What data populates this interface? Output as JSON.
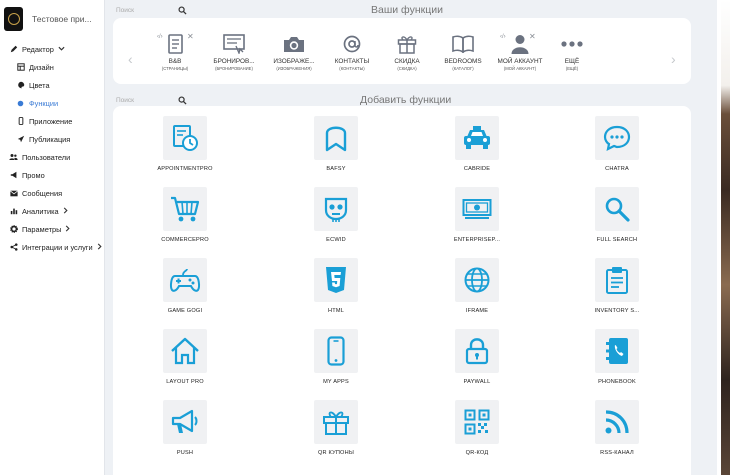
{
  "app": {
    "title": "Тестовое при..."
  },
  "sidebar": {
    "items": [
      {
        "label": "Редактор",
        "icon": "pen-icon",
        "caret": "v"
      },
      {
        "label": "Дизайн",
        "icon": "layout-icon"
      },
      {
        "label": "Цвета",
        "icon": "palette-icon"
      },
      {
        "label": "Функции",
        "icon": "circle-icon"
      },
      {
        "label": "Приложение",
        "icon": "phone-icon"
      },
      {
        "label": "Публикация",
        "icon": "send-icon"
      },
      {
        "label": "Пользователи",
        "icon": "users-icon"
      },
      {
        "label": "Промо",
        "icon": "megaphone-icon"
      },
      {
        "label": "Сообщения",
        "icon": "envelope-icon"
      },
      {
        "label": "Аналитика",
        "icon": "chart-icon",
        "caret": ">"
      },
      {
        "label": "Параметры",
        "icon": "gear-icon",
        "caret": ">"
      },
      {
        "label": "Интеграции и услуги",
        "icon": "share-icon",
        "caret": ">"
      }
    ]
  },
  "top_search": {
    "placeholder": "Поиск"
  },
  "your_functions": {
    "title": "Ваши функции",
    "items": [
      {
        "label": "B&B",
        "sub": "(СТРАНИЦЫ)",
        "icon": "document-icon"
      },
      {
        "label": "БРОНИРОВ...",
        "sub": "(БРОНИРОВАНИЕ)",
        "icon": "booking-icon"
      },
      {
        "label": "ИЗОБРАЖЕ...",
        "sub": "(ИЗОБРАЖЕНИЯ)",
        "icon": "camera-icon"
      },
      {
        "label": "КОНТАКТЫ",
        "sub": "(КОНТАКТЫ)",
        "icon": "at-icon"
      },
      {
        "label": "СКИДКА",
        "sub": "(СКИДКА)",
        "icon": "gift-icon"
      },
      {
        "label": "BEDROOMS",
        "sub": "(КАТАЛОГ)",
        "icon": "book-icon"
      },
      {
        "label": "МОЙ АККАУНТ",
        "sub": "(МОЙ АККАУНТ)",
        "icon": "user-icon"
      },
      {
        "label": "ЕЩЁ",
        "sub": "(ЕЩЁ)",
        "icon": "more-icon"
      }
    ],
    "glyphs": {
      "move": "‹/›",
      "remove": "✕",
      "prev": "‹",
      "next": "›"
    }
  },
  "add_search": {
    "placeholder": "Поиск"
  },
  "add_functions": {
    "title": "Добавить функции",
    "accent": "#1a9fd6",
    "items": [
      {
        "name": "APPOINTMENTPRO",
        "icon": "appointment-icon"
      },
      {
        "name": "BAFSY",
        "icon": "bafsy-icon"
      },
      {
        "name": "CABRIDE",
        "icon": "taxi-icon"
      },
      {
        "name": "CHATRA",
        "icon": "chat-icon"
      },
      {
        "name": "COMMERCEPRO",
        "icon": "cart-icon"
      },
      {
        "name": "ECWID",
        "icon": "ecwid-icon"
      },
      {
        "name": "ENTERPRISEP...",
        "icon": "money-icon"
      },
      {
        "name": "FULL SEARCH",
        "icon": "search-icon"
      },
      {
        "name": "GAME GOGI",
        "icon": "gamepad-icon"
      },
      {
        "name": "HTML",
        "icon": "html5-icon"
      },
      {
        "name": "IFRAME",
        "icon": "globe-icon"
      },
      {
        "name": "INVENTORY S...",
        "icon": "clipboard-icon"
      },
      {
        "name": "LAYOUT PRO",
        "icon": "home-icon"
      },
      {
        "name": "MY APPS",
        "icon": "mobile-icon"
      },
      {
        "name": "PAYWALL",
        "icon": "lock-icon"
      },
      {
        "name": "PHONEBOOK",
        "icon": "phonebook-icon"
      },
      {
        "name": "PUSH",
        "icon": "bullhorn-icon"
      },
      {
        "name": "QR КУПОНЫ",
        "icon": "gift-icon"
      },
      {
        "name": "QR-КОД",
        "icon": "qr-icon"
      },
      {
        "name": "RSS-КАНАЛ",
        "icon": "rss-icon"
      }
    ]
  }
}
